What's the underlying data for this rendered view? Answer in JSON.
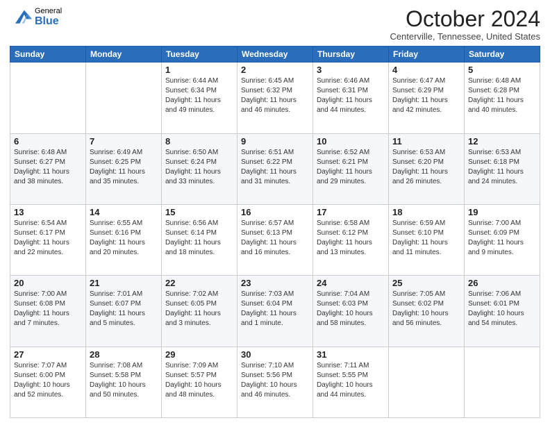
{
  "logo": {
    "general": "General",
    "blue": "Blue"
  },
  "header": {
    "month": "October 2024",
    "location": "Centerville, Tennessee, United States"
  },
  "weekdays": [
    "Sunday",
    "Monday",
    "Tuesday",
    "Wednesday",
    "Thursday",
    "Friday",
    "Saturday"
  ],
  "weeks": [
    [
      {
        "day": "",
        "info": ""
      },
      {
        "day": "",
        "info": ""
      },
      {
        "day": "1",
        "info": "Sunrise: 6:44 AM\nSunset: 6:34 PM\nDaylight: 11 hours and 49 minutes."
      },
      {
        "day": "2",
        "info": "Sunrise: 6:45 AM\nSunset: 6:32 PM\nDaylight: 11 hours and 46 minutes."
      },
      {
        "day": "3",
        "info": "Sunrise: 6:46 AM\nSunset: 6:31 PM\nDaylight: 11 hours and 44 minutes."
      },
      {
        "day": "4",
        "info": "Sunrise: 6:47 AM\nSunset: 6:29 PM\nDaylight: 11 hours and 42 minutes."
      },
      {
        "day": "5",
        "info": "Sunrise: 6:48 AM\nSunset: 6:28 PM\nDaylight: 11 hours and 40 minutes."
      }
    ],
    [
      {
        "day": "6",
        "info": "Sunrise: 6:48 AM\nSunset: 6:27 PM\nDaylight: 11 hours and 38 minutes."
      },
      {
        "day": "7",
        "info": "Sunrise: 6:49 AM\nSunset: 6:25 PM\nDaylight: 11 hours and 35 minutes."
      },
      {
        "day": "8",
        "info": "Sunrise: 6:50 AM\nSunset: 6:24 PM\nDaylight: 11 hours and 33 minutes."
      },
      {
        "day": "9",
        "info": "Sunrise: 6:51 AM\nSunset: 6:22 PM\nDaylight: 11 hours and 31 minutes."
      },
      {
        "day": "10",
        "info": "Sunrise: 6:52 AM\nSunset: 6:21 PM\nDaylight: 11 hours and 29 minutes."
      },
      {
        "day": "11",
        "info": "Sunrise: 6:53 AM\nSunset: 6:20 PM\nDaylight: 11 hours and 26 minutes."
      },
      {
        "day": "12",
        "info": "Sunrise: 6:53 AM\nSunset: 6:18 PM\nDaylight: 11 hours and 24 minutes."
      }
    ],
    [
      {
        "day": "13",
        "info": "Sunrise: 6:54 AM\nSunset: 6:17 PM\nDaylight: 11 hours and 22 minutes."
      },
      {
        "day": "14",
        "info": "Sunrise: 6:55 AM\nSunset: 6:16 PM\nDaylight: 11 hours and 20 minutes."
      },
      {
        "day": "15",
        "info": "Sunrise: 6:56 AM\nSunset: 6:14 PM\nDaylight: 11 hours and 18 minutes."
      },
      {
        "day": "16",
        "info": "Sunrise: 6:57 AM\nSunset: 6:13 PM\nDaylight: 11 hours and 16 minutes."
      },
      {
        "day": "17",
        "info": "Sunrise: 6:58 AM\nSunset: 6:12 PM\nDaylight: 11 hours and 13 minutes."
      },
      {
        "day": "18",
        "info": "Sunrise: 6:59 AM\nSunset: 6:10 PM\nDaylight: 11 hours and 11 minutes."
      },
      {
        "day": "19",
        "info": "Sunrise: 7:00 AM\nSunset: 6:09 PM\nDaylight: 11 hours and 9 minutes."
      }
    ],
    [
      {
        "day": "20",
        "info": "Sunrise: 7:00 AM\nSunset: 6:08 PM\nDaylight: 11 hours and 7 minutes."
      },
      {
        "day": "21",
        "info": "Sunrise: 7:01 AM\nSunset: 6:07 PM\nDaylight: 11 hours and 5 minutes."
      },
      {
        "day": "22",
        "info": "Sunrise: 7:02 AM\nSunset: 6:05 PM\nDaylight: 11 hours and 3 minutes."
      },
      {
        "day": "23",
        "info": "Sunrise: 7:03 AM\nSunset: 6:04 PM\nDaylight: 11 hours and 1 minute."
      },
      {
        "day": "24",
        "info": "Sunrise: 7:04 AM\nSunset: 6:03 PM\nDaylight: 10 hours and 58 minutes."
      },
      {
        "day": "25",
        "info": "Sunrise: 7:05 AM\nSunset: 6:02 PM\nDaylight: 10 hours and 56 minutes."
      },
      {
        "day": "26",
        "info": "Sunrise: 7:06 AM\nSunset: 6:01 PM\nDaylight: 10 hours and 54 minutes."
      }
    ],
    [
      {
        "day": "27",
        "info": "Sunrise: 7:07 AM\nSunset: 6:00 PM\nDaylight: 10 hours and 52 minutes."
      },
      {
        "day": "28",
        "info": "Sunrise: 7:08 AM\nSunset: 5:58 PM\nDaylight: 10 hours and 50 minutes."
      },
      {
        "day": "29",
        "info": "Sunrise: 7:09 AM\nSunset: 5:57 PM\nDaylight: 10 hours and 48 minutes."
      },
      {
        "day": "30",
        "info": "Sunrise: 7:10 AM\nSunset: 5:56 PM\nDaylight: 10 hours and 46 minutes."
      },
      {
        "day": "31",
        "info": "Sunrise: 7:11 AM\nSunset: 5:55 PM\nDaylight: 10 hours and 44 minutes."
      },
      {
        "day": "",
        "info": ""
      },
      {
        "day": "",
        "info": ""
      }
    ]
  ]
}
